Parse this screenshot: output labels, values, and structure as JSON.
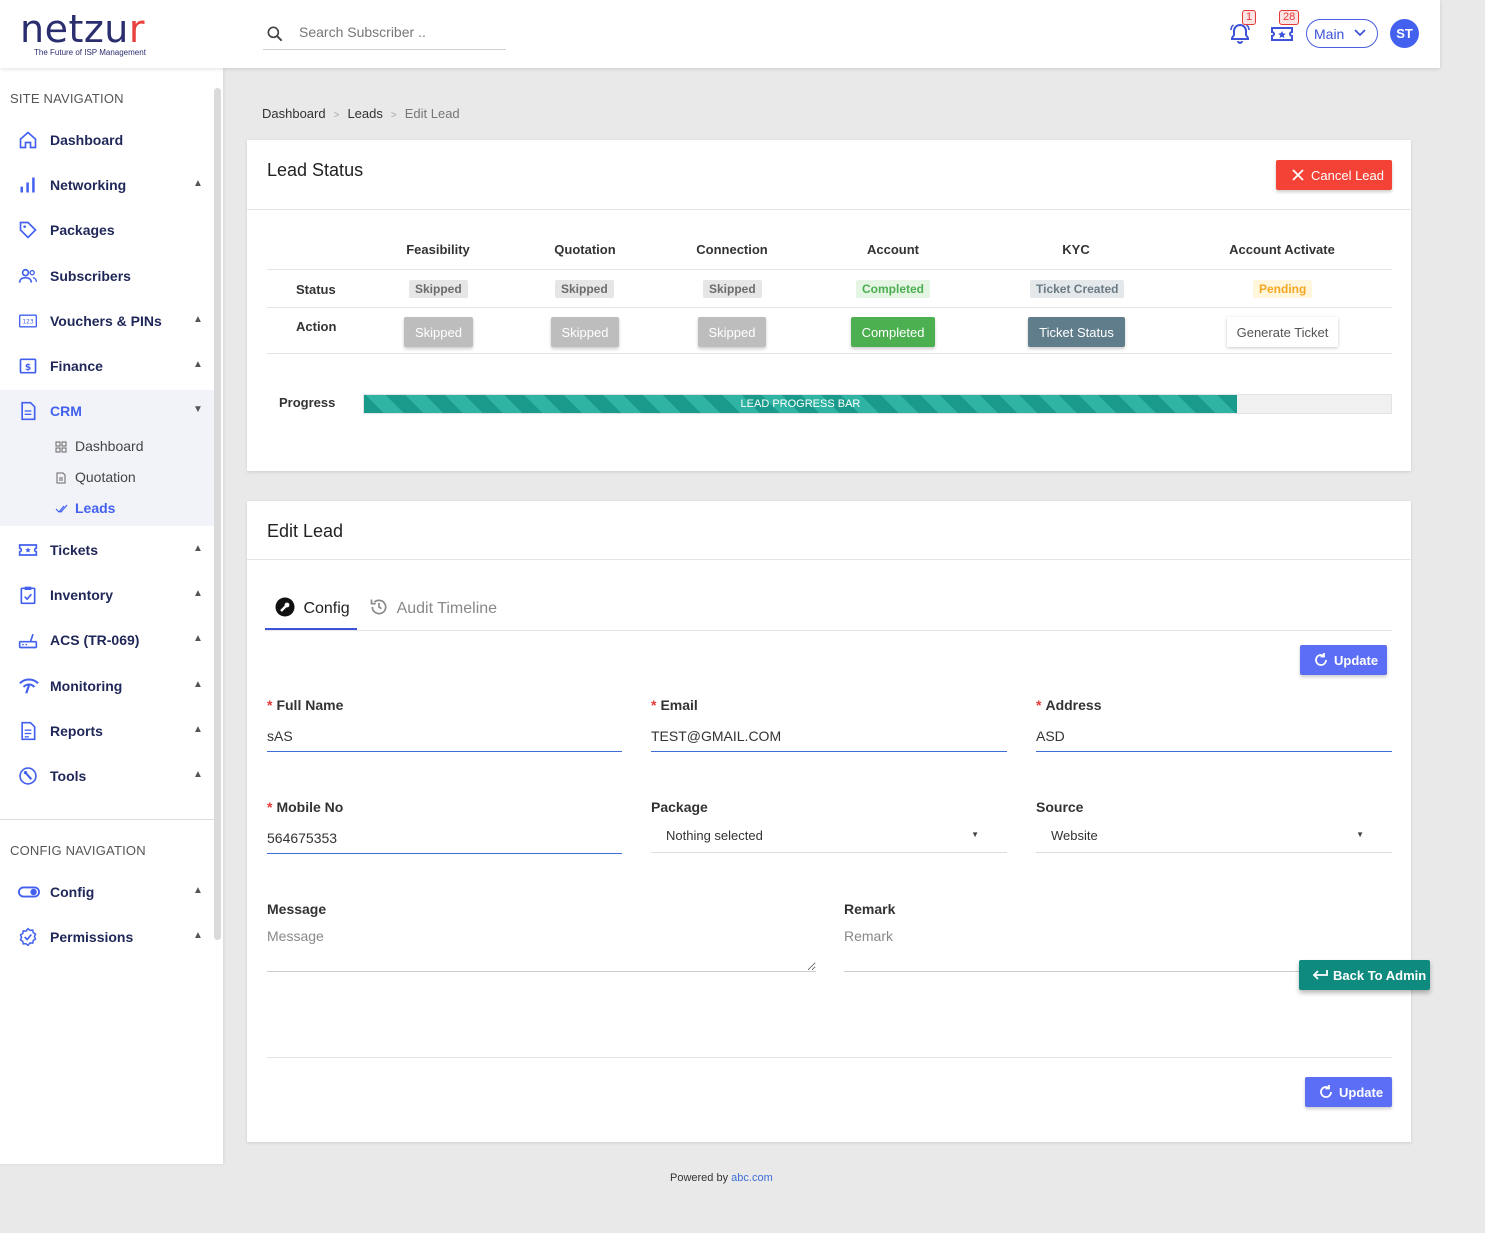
{
  "brand": {
    "name_main": "netzu",
    "name_accent": "r",
    "tagline": "The Future of ISP Management"
  },
  "search": {
    "placeholder": "Search Subscriber .."
  },
  "notifications": {
    "bell_count": "1",
    "ticket_count": "28"
  },
  "account_menu": {
    "label": "Main"
  },
  "user": {
    "initials": "ST"
  },
  "sidebar": {
    "site_nav_title": "SITE NAVIGATION",
    "items": [
      {
        "label": "Dashboard",
        "icon": "home-icon"
      },
      {
        "label": "Networking",
        "icon": "bar-chart-icon",
        "caret": "▲"
      },
      {
        "label": "Packages",
        "icon": "tag-icon"
      },
      {
        "label": "Subscribers",
        "icon": "users-icon"
      },
      {
        "label": "Vouchers & PINs",
        "icon": "voucher-icon",
        "caret": "▲"
      },
      {
        "label": "Finance",
        "icon": "dollar-icon",
        "caret": "▲"
      },
      {
        "label": "CRM",
        "icon": "document-icon",
        "caret": "▼"
      },
      {
        "label": "Tickets",
        "icon": "ticket-icon",
        "caret": "▲"
      },
      {
        "label": "Inventory",
        "icon": "clipboard-icon",
        "caret": "▲"
      },
      {
        "label": "ACS (TR-069)",
        "icon": "router-icon",
        "caret": "▲"
      },
      {
        "label": "Monitoring",
        "icon": "wifi-icon",
        "caret": "▲"
      },
      {
        "label": "Reports",
        "icon": "report-icon",
        "caret": "▲"
      },
      {
        "label": "Tools",
        "icon": "tools-icon",
        "caret": "▲"
      }
    ],
    "crm_sub": [
      {
        "label": "Dashboard",
        "icon": "grid-icon"
      },
      {
        "label": "Quotation",
        "icon": "file-icon"
      },
      {
        "label": "Leads",
        "icon": "check-icon"
      }
    ],
    "config_nav_title": "CONFIG NAVIGATION",
    "config_items": [
      {
        "label": "Config",
        "icon": "toggle-icon",
        "caret": "▲"
      },
      {
        "label": "Permissions",
        "icon": "badge-check-icon",
        "caret": "▲"
      }
    ]
  },
  "breadcrumb": {
    "items": [
      "Dashboard",
      "Leads"
    ],
    "current": "Edit Lead",
    "separator": ">"
  },
  "lead_status": {
    "title": "Lead Status",
    "cancel_label": "Cancel Lead",
    "columns": [
      "Feasibility",
      "Quotation",
      "Connection",
      "Account",
      "KYC",
      "Account Activate"
    ],
    "status_label": "Status",
    "action_label": "Action",
    "statuses": [
      "Skipped",
      "Skipped",
      "Skipped",
      "Completed",
      "Ticket Created",
      "Pending"
    ],
    "actions": [
      "Skipped",
      "Skipped",
      "Skipped",
      "Completed",
      "Ticket Status",
      "Generate Ticket"
    ],
    "progress_label": "Progress",
    "progress_bar_text": "LEAD PROGRESS BAR",
    "progress_percent": 85
  },
  "edit_lead": {
    "title": "Edit Lead",
    "tabs": [
      "Config",
      "Audit Timeline"
    ],
    "update_label": "Update",
    "fields": {
      "full_name": {
        "label": "Full Name",
        "value": "sAS"
      },
      "email": {
        "label": "Email",
        "value": "TEST@GMAIL.COM"
      },
      "address": {
        "label": "Address",
        "value": "ASD"
      },
      "mobile": {
        "label": "Mobile No",
        "value": "564675353"
      },
      "package": {
        "label": "Package",
        "value": "Nothing selected"
      },
      "source": {
        "label": "Source",
        "value": "Website"
      },
      "message": {
        "label": "Message",
        "placeholder": "Message"
      },
      "remark": {
        "label": "Remark",
        "placeholder": "Remark"
      }
    },
    "required_mark": "*"
  },
  "back_to_admin": {
    "label": "Back To Admin"
  },
  "footer": {
    "text": "Powered by",
    "link": "abc.com"
  },
  "colors": {
    "primary": "#3d53d8",
    "danger": "#f44336",
    "success": "#4caf50",
    "teal": "#0f8a7e",
    "update": "#5b6ef5"
  }
}
